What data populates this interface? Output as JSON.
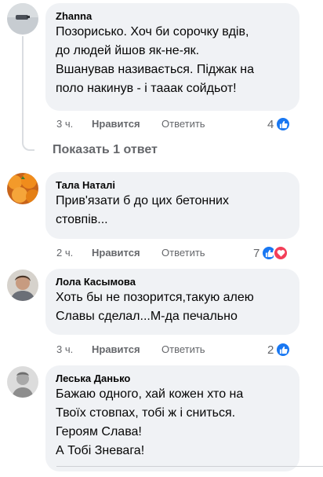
{
  "comments": [
    {
      "author": "Zhanna",
      "text": "Позорисько. Хоч би сорочку вдів,\nдо людей йшов як-не-як.\nВшанував називається. Піджак на\nполо накинув - і тааак сойдьот!",
      "time": "3 ч.",
      "like": "Нравится",
      "reply": "Ответить",
      "reactions": "4"
    },
    {
      "author": "Тала Наталі",
      "text": "Прив'язати б до цих бетонних\nстовпів...",
      "time": "2 ч.",
      "like": "Нравится",
      "reply": "Ответить",
      "reactions": "7"
    },
    {
      "author": "Лола Касымова",
      "text": "Хоть бы не позорится,такую алею\nСлавы сделал...М-да печально",
      "time": "3 ч.",
      "like": "Нравится",
      "reply": "Ответить",
      "reactions": "2"
    },
    {
      "author": "Леська Данько",
      "text": "Бажаю одного, хай кожен хто на\nТвоїх стовпах, тобі ж і сниться.\nГероям Слава!\nА Тобі Зневага!"
    }
  ],
  "thread": {
    "show_replies": "Показать 1 ответ"
  },
  "colors": {
    "like_blue": "#1877f2",
    "love_red": "#f33e58",
    "bubble_bg": "#f0f2f5",
    "meta_gray": "#65676b"
  }
}
